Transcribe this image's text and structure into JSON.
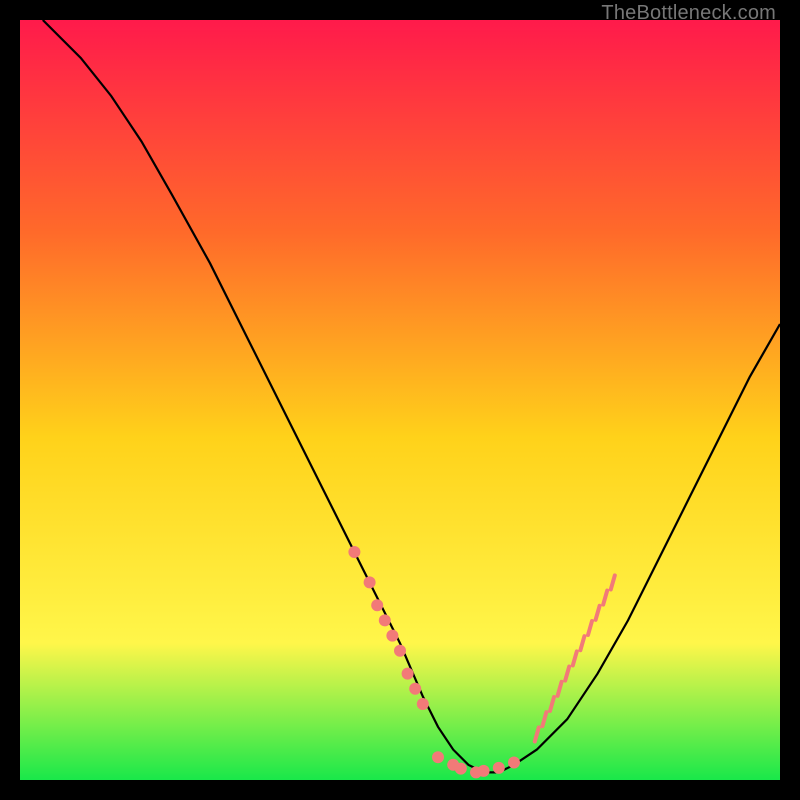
{
  "watermark": "TheBottleneck.com",
  "colors": {
    "bg": "#000000",
    "gradient_top": "#ff1a4b",
    "gradient_mid1": "#ff6a2a",
    "gradient_mid2": "#ffd21a",
    "gradient_mid3": "#fff64a",
    "gradient_bottom": "#19e84a",
    "curve": "#000000",
    "marker": "#f27a78"
  },
  "chart_data": {
    "type": "line",
    "title": "",
    "xlabel": "",
    "ylabel": "",
    "xlim": [
      0,
      100
    ],
    "ylim": [
      0,
      100
    ],
    "series": [
      {
        "name": "curve",
        "x": [
          3,
          8,
          12,
          16,
          20,
          25,
          30,
          35,
          40,
          45,
          50,
          53,
          55,
          57,
          59,
          61,
          63,
          65,
          68,
          72,
          76,
          80,
          84,
          88,
          92,
          96,
          100
        ],
        "y": [
          100,
          95,
          90,
          84,
          77,
          68,
          58,
          48,
          38,
          28,
          18,
          11,
          7,
          4,
          2,
          1,
          1,
          2,
          4,
          8,
          14,
          21,
          29,
          37,
          45,
          53,
          60
        ]
      }
    ],
    "markers_left": {
      "x": [
        44,
        46,
        47,
        48,
        49,
        50,
        51,
        52,
        53
      ],
      "y": [
        30,
        26,
        23,
        21,
        19,
        17,
        14,
        12,
        10
      ]
    },
    "markers_bottom": {
      "x": [
        55,
        57,
        58,
        60,
        61,
        63,
        65
      ],
      "y": [
        3,
        2,
        1.5,
        1,
        1.2,
        1.6,
        2.3
      ]
    },
    "markers_right": {
      "x": [
        68,
        69,
        70,
        71,
        72,
        73,
        74,
        75,
        76,
        77,
        78
      ],
      "y": [
        6,
        8,
        10,
        12,
        14,
        16,
        18,
        20,
        22,
        24,
        26
      ]
    }
  }
}
